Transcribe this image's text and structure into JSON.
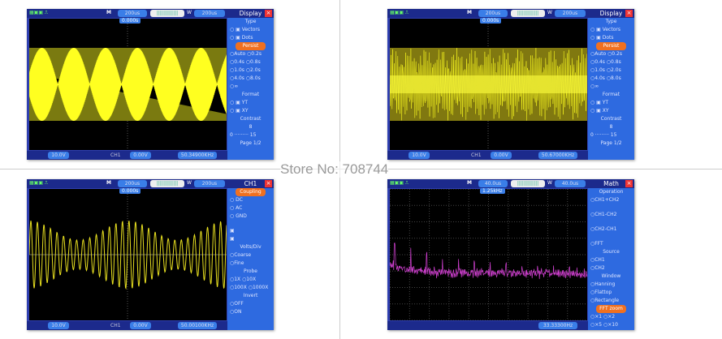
{
  "watermark": "Store No: 708744",
  "colors": {
    "frame": "#2f3fb0",
    "menu": "#2e6ae0",
    "trace_yellow": "#ffff20",
    "trace_magenta": "#d040d0",
    "highlight": "#f07020"
  },
  "panels": [
    {
      "id": "display-1",
      "timebase": "200us",
      "window": "200us",
      "trigger_pos": "0.000s",
      "ch_scale": "10.0V",
      "trig_src": "CH1",
      "trig_level": "0.00V",
      "freq": "50.34900KHz",
      "wave": "am-full",
      "menu_title": "Display",
      "menu": [
        {
          "t": "Type",
          "c": 1
        },
        {
          "t": "○ ▣ Vectors"
        },
        {
          "t": "○ ▣ Dots"
        },
        {
          "t": "Persist",
          "h": 1
        },
        {
          "t": "○Auto ○0.2s"
        },
        {
          "t": "○0.4s ○0.8s"
        },
        {
          "t": "○1.0s ○2.0s"
        },
        {
          "t": "○4.0s ○8.0s"
        },
        {
          "t": "○∞"
        },
        {
          "t": "Format",
          "c": 1
        },
        {
          "t": "○ ▣ YT"
        },
        {
          "t": "○ ▣ XY"
        },
        {
          "t": "Contrast",
          "c": 1
        },
        {
          "t": "8",
          "c": 1
        },
        {
          "t": "0 ········· 15"
        },
        {
          "t": "Page 1/2",
          "c": 1
        }
      ]
    },
    {
      "id": "display-2",
      "timebase": "200us",
      "window": "200us",
      "trigger_pos": "0.000s",
      "ch_scale": "10.0V",
      "trig_src": "CH1",
      "trig_level": "0.00V",
      "freq": "50.67000KHz",
      "wave": "dense",
      "menu_title": "Display",
      "menu": [
        {
          "t": "Type",
          "c": 1
        },
        {
          "t": "○ ▣ Vectors"
        },
        {
          "t": "○ ▣ Dots"
        },
        {
          "t": "Persist",
          "h": 1
        },
        {
          "t": "○Auto ○0.2s"
        },
        {
          "t": "○0.4s ○0.8s"
        },
        {
          "t": "○1.0s ○2.0s"
        },
        {
          "t": "○4.0s ○8.0s"
        },
        {
          "t": "○∞"
        },
        {
          "t": "Format",
          "c": 1
        },
        {
          "t": "○ ▣ YT"
        },
        {
          "t": "○ ▣ XY"
        },
        {
          "t": "Contrast",
          "c": 1
        },
        {
          "t": "8",
          "c": 1
        },
        {
          "t": "0 ········· 15"
        },
        {
          "t": "Page 1/2",
          "c": 1
        }
      ]
    },
    {
      "id": "ch1",
      "timebase": "200us",
      "window": "200us",
      "trigger_pos": "0.000s",
      "ch_scale": "10.0V",
      "trig_src": "CH1",
      "trig_level": "0.00V",
      "freq": "50.00100KHz",
      "wave": "am-sine",
      "menu_title": "CH1",
      "menu": [
        {
          "t": "Coupling",
          "h": 1
        },
        {
          "t": "○ DC"
        },
        {
          "t": "○ AC"
        },
        {
          "t": "○ GND"
        },
        {
          "t": ""
        },
        {
          "t": "   ▣"
        },
        {
          "t": "   ▣"
        },
        {
          "t": "Volts/Div",
          "c": 1
        },
        {
          "t": "○Coarse"
        },
        {
          "t": "○Fine"
        },
        {
          "t": "Probe",
          "c": 1
        },
        {
          "t": "○1X   ○10X"
        },
        {
          "t": "○100X ○1000X"
        },
        {
          "t": "Invert",
          "c": 1
        },
        {
          "t": "○OFF"
        },
        {
          "t": "○ON"
        }
      ]
    },
    {
      "id": "math",
      "timebase": "40.0us",
      "window": "40.0us",
      "trigger_pos": "1.25kHz",
      "ch_scale": "",
      "trig_src": "",
      "trig_level": "",
      "freq": "33.33300Hz",
      "wave": "fft",
      "menu_title": "Math",
      "menu": [
        {
          "t": "Operation",
          "c": 1
        },
        {
          "t": "○CH1+CH2"
        },
        {
          "t": ""
        },
        {
          "t": "○CH1-CH2"
        },
        {
          "t": ""
        },
        {
          "t": "○CH2-CH1"
        },
        {
          "t": ""
        },
        {
          "t": "○FFT"
        },
        {
          "t": "Source",
          "c": 1
        },
        {
          "t": "○CH1"
        },
        {
          "t": "○CH2"
        },
        {
          "t": "Window",
          "c": 1
        },
        {
          "t": "○Hanning"
        },
        {
          "t": "○Flattop"
        },
        {
          "t": "○Rectangle"
        },
        {
          "t": "FFT zoom",
          "h": 1
        },
        {
          "t": "○×1   ○×2"
        },
        {
          "t": "○×5   ○×10"
        }
      ]
    }
  ]
}
